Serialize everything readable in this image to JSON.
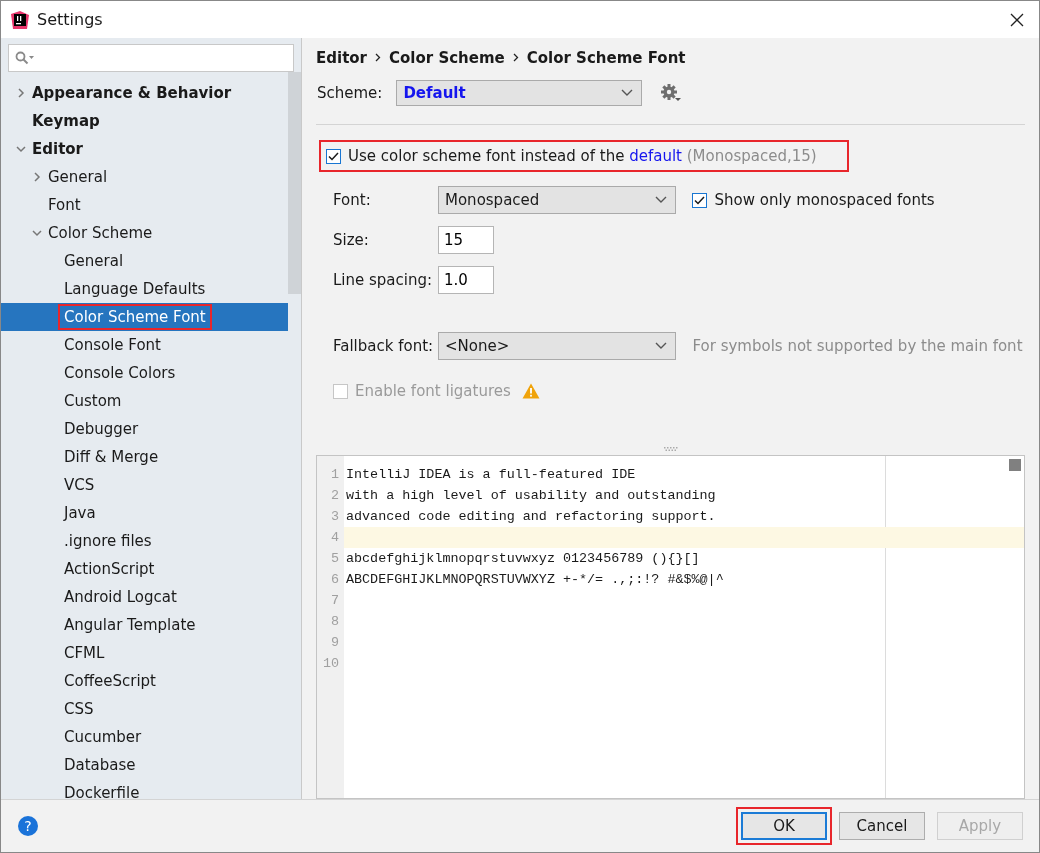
{
  "window": {
    "title": "Settings"
  },
  "sidebar": {
    "tree": [
      {
        "label": "Appearance & Behavior",
        "selected": false,
        "expanded": false,
        "annotated": false
      },
      {
        "label": "Keymap",
        "selected": false,
        "annotated": false
      },
      {
        "label": "Editor",
        "selected": false,
        "expanded": true,
        "annotated": false,
        "children": [
          {
            "label": "General",
            "selected": false,
            "expanded": false,
            "annotated": false
          },
          {
            "label": "Font",
            "selected": false,
            "annotated": false
          },
          {
            "label": "Color Scheme",
            "selected": false,
            "expanded": true,
            "annotated": false,
            "children": [
              {
                "label": "General",
                "selected": false,
                "annotated": false
              },
              {
                "label": "Language Defaults",
                "selected": false,
                "annotated": false
              },
              {
                "label": "Color Scheme Font",
                "selected": true,
                "annotated": true
              },
              {
                "label": "Console Font",
                "selected": false,
                "annotated": false
              },
              {
                "label": "Console Colors",
                "selected": false,
                "annotated": false
              },
              {
                "label": "Custom",
                "selected": false,
                "annotated": false
              },
              {
                "label": "Debugger",
                "selected": false,
                "annotated": false
              },
              {
                "label": "Diff & Merge",
                "selected": false,
                "annotated": false
              },
              {
                "label": "VCS",
                "selected": false,
                "annotated": false
              },
              {
                "label": "Java",
                "selected": false,
                "annotated": false
              },
              {
                "label": ".ignore files",
                "selected": false,
                "annotated": false
              },
              {
                "label": "ActionScript",
                "selected": false,
                "annotated": false
              },
              {
                "label": "Android Logcat",
                "selected": false,
                "annotated": false
              },
              {
                "label": "Angular Template",
                "selected": false,
                "annotated": false
              },
              {
                "label": "CFML",
                "selected": false,
                "annotated": false
              },
              {
                "label": "CoffeeScript",
                "selected": false,
                "annotated": false
              },
              {
                "label": "CSS",
                "selected": false,
                "annotated": false
              },
              {
                "label": "Cucumber",
                "selected": false,
                "annotated": false
              },
              {
                "label": "Database",
                "selected": false,
                "annotated": false
              },
              {
                "label": "Dockerfile",
                "selected": false,
                "annotated": false
              }
            ]
          }
        ]
      }
    ]
  },
  "breadcrumb": [
    "Editor",
    "Color Scheme",
    "Color Scheme Font"
  ],
  "scheme": {
    "label": "Scheme:",
    "value": "Default"
  },
  "use_scheme_font": {
    "checked": true,
    "annotated": true,
    "text": "Use color scheme font instead of the ",
    "link": "default",
    "note": " (Monospaced,15)"
  },
  "font": {
    "label": "Font:",
    "value": "Monospaced",
    "show_only_monospaced": {
      "label": "Show only monospaced fonts",
      "checked": true
    }
  },
  "size": {
    "label": "Size:",
    "value": "15"
  },
  "line_spacing": {
    "label": "Line spacing:",
    "value": "1.0"
  },
  "fallback": {
    "label": "Fallback font:",
    "value": "<None>",
    "hint": "For symbols not supported by the main font"
  },
  "ligatures": {
    "label": "Enable font ligatures",
    "checked": false,
    "disabled": true
  },
  "preview": {
    "lines": [
      {
        "number": "1",
        "text": "IntelliJ IDEA is a full-featured IDE",
        "current": false
      },
      {
        "number": "2",
        "text": "with a high level of usability and outstanding",
        "current": false
      },
      {
        "number": "3",
        "text": "advanced code editing and refactoring support.",
        "current": false
      },
      {
        "number": "4",
        "current": true
      },
      {
        "number": "5",
        "text": "abcdefghijklmnopqrstuvwxyz 0123456789 (){}[]",
        "current": false
      },
      {
        "number": "6",
        "text": "ABCDEFGHIJKLMNOPQRSTUVWXYZ +-*/= .,;:!? #&$%@|^",
        "current": false
      },
      {
        "number": "7",
        "current": false
      },
      {
        "number": "8",
        "current": false
      },
      {
        "number": "9",
        "current": false
      },
      {
        "number": "10",
        "current": false
      }
    ]
  },
  "footer": {
    "help": "?",
    "buttons": [
      {
        "label": "OK",
        "kind": "default",
        "disabled": false,
        "annotated": true
      },
      {
        "label": "Cancel",
        "kind": "normal",
        "disabled": false,
        "annotated": false
      },
      {
        "label": "Apply",
        "kind": "normal",
        "disabled": true,
        "annotated": false
      }
    ]
  }
}
